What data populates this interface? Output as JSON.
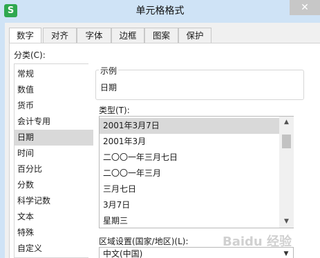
{
  "window": {
    "title": "单元格格式",
    "app_icon_letter": "S",
    "close_glyph": "✕"
  },
  "tabs": [
    {
      "label": "数字",
      "active": true
    },
    {
      "label": "对齐",
      "active": false
    },
    {
      "label": "字体",
      "active": false
    },
    {
      "label": "边框",
      "active": false
    },
    {
      "label": "图案",
      "active": false
    },
    {
      "label": "保护",
      "active": false
    }
  ],
  "category": {
    "label": "分类(C):",
    "items": [
      "常规",
      "数值",
      "货币",
      "会计专用",
      "日期",
      "时间",
      "百分比",
      "分数",
      "科学记数",
      "文本",
      "特殊",
      "自定义"
    ],
    "selected": "日期"
  },
  "sample": {
    "legend": "示例",
    "value": "日期"
  },
  "type": {
    "label": "类型(T):",
    "items": [
      "2001年3月7日",
      "2001年3月",
      "二〇〇一年三月七日",
      "二〇〇一年三月",
      "三月七日",
      "3月7日",
      "星期三"
    ],
    "selected": "2001年3月7日"
  },
  "locale": {
    "label": "区域设置(国家/地区)(L):",
    "value": "中文(中国)"
  },
  "watermark": "Baidu 经验",
  "colors": {
    "title_bar": "#cfe3f6",
    "selection": "#d9d9d9",
    "app_icon": "#2fa84f"
  }
}
